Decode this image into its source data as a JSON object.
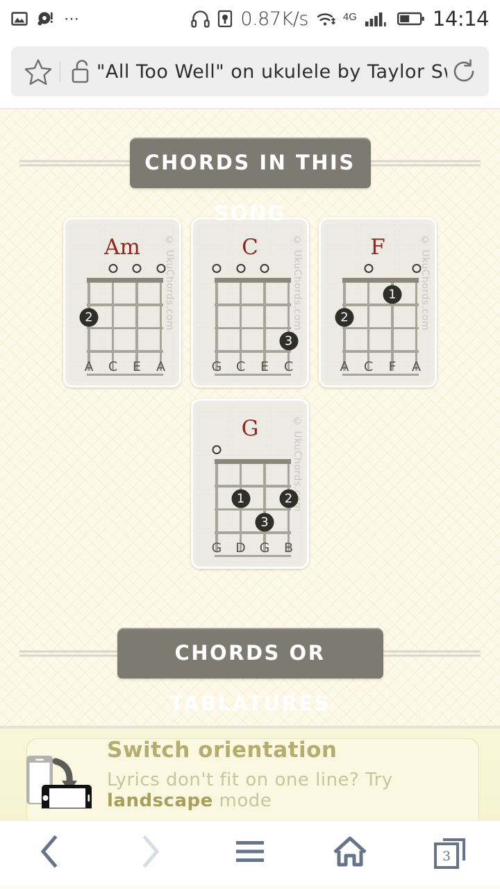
{
  "status_bar": {
    "left_icons": [
      "image-icon",
      "notification-alert-icon",
      "more-dots-icon"
    ],
    "headphone_icon": "headphone-icon",
    "device_icon": "device-icon",
    "network_speed": "0.87K/s",
    "wifi_icon": "wifi-icon",
    "network_type": "4G",
    "signal_icon": "signal-bars-icon",
    "battery_icon": "battery-icon",
    "time": "14:14"
  },
  "browser": {
    "star_icon": "star-icon",
    "lock_icon": "unlocked-padlock-icon",
    "url_text": "\"All Too Well\" on ukulele by Taylor Sw",
    "reload_icon": "reload-icon"
  },
  "page": {
    "section_header": "CHORDS IN THIS SONG",
    "footer_header": "CHORDS OR TABLATURES",
    "watermark": "© UkuChords.com",
    "accent_color": "#8c2a21",
    "banner_color": "#7d7a71",
    "chords": [
      {
        "name": "Am",
        "strings": [
          "A",
          "C",
          "E",
          "A"
        ],
        "open_strings": [
          2,
          3,
          4
        ],
        "fingers": [
          {
            "string": 1,
            "fret": 2,
            "finger": "2"
          }
        ]
      },
      {
        "name": "C",
        "strings": [
          "G",
          "C",
          "E",
          "C"
        ],
        "open_strings": [
          1,
          2,
          3
        ],
        "fingers": [
          {
            "string": 4,
            "fret": 3,
            "finger": "3"
          }
        ]
      },
      {
        "name": "F",
        "strings": [
          "A",
          "C",
          "F",
          "A"
        ],
        "open_strings": [
          2,
          4
        ],
        "fingers": [
          {
            "string": 3,
            "fret": 1,
            "finger": "1"
          },
          {
            "string": 1,
            "fret": 2,
            "finger": "2"
          }
        ]
      },
      {
        "name": "G",
        "strings": [
          "G",
          "D",
          "G",
          "B"
        ],
        "open_strings": [
          1
        ],
        "fingers": [
          {
            "string": 2,
            "fret": 2,
            "finger": "1"
          },
          {
            "string": 4,
            "fret": 2,
            "finger": "2"
          },
          {
            "string": 3,
            "fret": 3,
            "finger": "3"
          }
        ]
      }
    ]
  },
  "orientation_banner": {
    "icon": "rotate-device-icon",
    "title": "Switch orientation",
    "subtitle_before": "Lyrics don't fit on one line? Try ",
    "subtitle_bold": "landscape",
    "subtitle_after": " mode"
  },
  "navbar": {
    "back_icon": "back-arrow-icon",
    "forward_icon": "forward-arrow-icon",
    "menu_icon": "hamburger-menu-icon",
    "home_icon": "home-icon",
    "tabs_icon": "tabs-icon",
    "tab_count": "3"
  }
}
